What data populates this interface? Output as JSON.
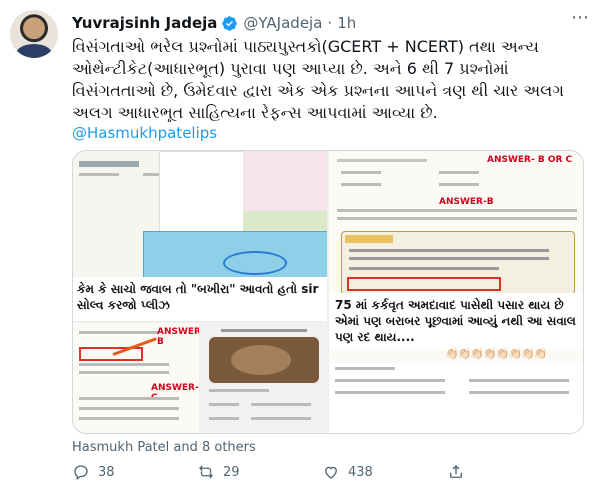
{
  "author": {
    "name": "Yuvrajsinh Jadeja",
    "handle": "@YAJadeja",
    "separator": "·",
    "time": "1h"
  },
  "tweet": {
    "text": "વિસંગતાઓ ભરેલ પ્રશ્નોમાં પાઠ્યપુસ્તકો(GCERT + NCERT) તથા અન્ય ઓથેન્ટીકેટ(આધારભૂત) પુરાવા પણ આપ્યા છે. અને 6 થી 7 પ્રશ્નોમાં વિસંગતતાઓ છે, ઉમેદવાર દ્વારા એક એક પ્રશ્નના આપને ત્રણ થી ચાર અલગ અલગ આધારભૂત સાહિત્યના રેફન્સ આપવામાં આવ્યા છે.",
    "mention": "@Hasmukhpatelips"
  },
  "media": {
    "tile1_caption": "કેમ કે સાચો જવાબ તો \"બખીરા\" આવતો હતો sir સોલ્વ કરજો પ્લીઝ",
    "tile2_answer": "ANSWER- B OR C",
    "tile2_answer2": "ANSWER-B",
    "tile2_caption": "75 માં કર્કવૃત અમદાવાદ પાસેથી પસાર થાય છે એમાં પણ બરાબર પૂછવામાં આવ્યું નથી આ સવાલ પણ રદ થાય....",
    "tile2_emojis": "👏🏻👏🏻👏🏻👏🏻👏🏻👏🏻👏🏻👏🏻",
    "tile3_answer": "ANSWER-B",
    "tile3_answer2": "ANSWER-C"
  },
  "social_context": "Hasmukh Patel and 8 others",
  "actions": {
    "replies": "38",
    "retweets": "29",
    "likes": "438"
  },
  "colors": {
    "link": "#1d9bf0",
    "verified": "#1d9bf0",
    "muted": "#536471",
    "answer_red": "#d0021b"
  }
}
